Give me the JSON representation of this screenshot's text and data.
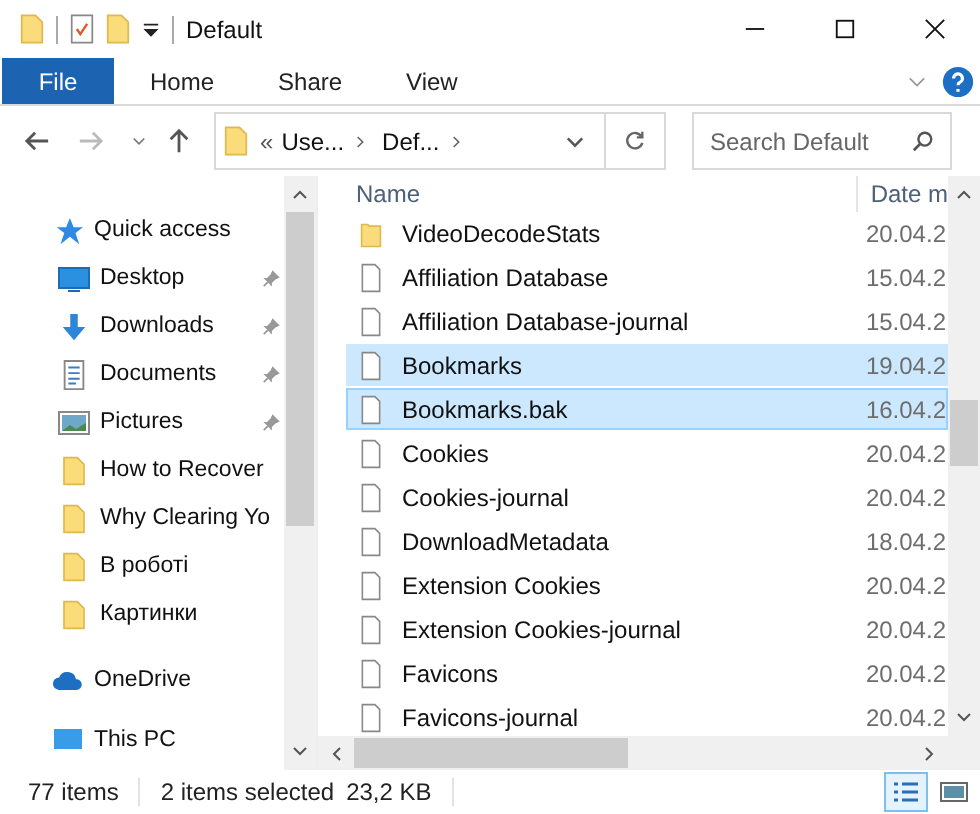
{
  "window": {
    "title": "Default"
  },
  "ribbon": {
    "file_tab": "File",
    "tabs": [
      {
        "label": "Home",
        "selected": false
      },
      {
        "label": "Share",
        "selected": false
      },
      {
        "label": "View",
        "selected": false
      }
    ]
  },
  "address": {
    "overflow": "«",
    "crumbs": [
      "Use...",
      "Def..."
    ],
    "search": {
      "placeholder": "Search Default"
    }
  },
  "nav": [
    {
      "label": "Quick access",
      "kind": "star",
      "children": [
        {
          "label": "Desktop",
          "kind": "desktop",
          "pinned": true
        },
        {
          "label": "Downloads",
          "kind": "downloads",
          "pinned": true
        },
        {
          "label": "Documents",
          "kind": "documents",
          "pinned": true
        },
        {
          "label": "Pictures",
          "kind": "pictures",
          "pinned": true
        },
        {
          "label": "How to Recover",
          "kind": "folder",
          "pinned": false
        },
        {
          "label": "Why Clearing Yo",
          "kind": "folder",
          "pinned": false
        },
        {
          "label": "В роботі",
          "kind": "folder",
          "pinned": false
        },
        {
          "label": "Картинки",
          "kind": "folder",
          "pinned": false
        }
      ]
    },
    {
      "label": "OneDrive",
      "kind": "cloud"
    },
    {
      "label": "This PC",
      "kind": "pc"
    }
  ],
  "table": {
    "columns": [
      "Name",
      "Date m"
    ],
    "rows": [
      {
        "name": "VideoDecodeStats",
        "date": "20.04.2",
        "kind": "folder",
        "selected": false,
        "focused": false
      },
      {
        "name": "Affiliation Database",
        "date": "15.04.2",
        "kind": "file",
        "selected": false,
        "focused": false
      },
      {
        "name": "Affiliation Database-journal",
        "date": "15.04.2",
        "kind": "file",
        "selected": false,
        "focused": false
      },
      {
        "name": "Bookmarks",
        "date": "19.04.2",
        "kind": "file",
        "selected": true,
        "focused": false
      },
      {
        "name": "Bookmarks.bak",
        "date": "16.04.2",
        "kind": "file",
        "selected": true,
        "focused": true
      },
      {
        "name": "Cookies",
        "date": "20.04.2",
        "kind": "file",
        "selected": false,
        "focused": false
      },
      {
        "name": "Cookies-journal",
        "date": "20.04.2",
        "kind": "file",
        "selected": false,
        "focused": false
      },
      {
        "name": "DownloadMetadata",
        "date": "18.04.2",
        "kind": "file",
        "selected": false,
        "focused": false
      },
      {
        "name": "Extension Cookies",
        "date": "20.04.2",
        "kind": "file",
        "selected": false,
        "focused": false
      },
      {
        "name": "Extension Cookies-journal",
        "date": "20.04.2",
        "kind": "file",
        "selected": false,
        "focused": false
      },
      {
        "name": "Favicons",
        "date": "20.04.2",
        "kind": "file",
        "selected": false,
        "focused": false
      },
      {
        "name": "Favicons-journal",
        "date": "20.04.2",
        "kind": "file",
        "selected": false,
        "focused": false
      }
    ]
  },
  "status_bar": {
    "count": "77 items",
    "selection": "2 items selected",
    "size": "23,2 KB",
    "views": [
      {
        "kind": "details",
        "selected": true
      },
      {
        "kind": "large",
        "selected": false
      }
    ]
  }
}
